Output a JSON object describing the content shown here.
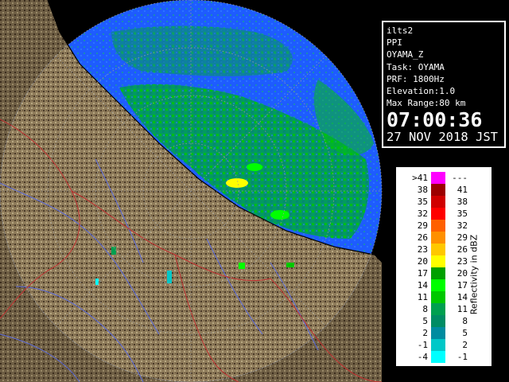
{
  "info": {
    "product": "ilts2",
    "scan_type": "PPI",
    "field": "OYAMA_Z",
    "task": "Task: OYAMA",
    "prf": "PRF: 1800Hz",
    "elevation": "Elevation:1.0",
    "max_range": "Max Range:80 km",
    "time": "07:00:36",
    "date": "27 NOV 2018 JST"
  },
  "legend": {
    "title": "Reflectivity in dBZ",
    "rows": [
      {
        "left": ">41",
        "right": "---",
        "color": "#ff00ff"
      },
      {
        "left": "38",
        "right": "41",
        "color": "#9c0000"
      },
      {
        "left": "35",
        "right": "38",
        "color": "#d00000"
      },
      {
        "left": "32",
        "right": "35",
        "color": "#ff0000"
      },
      {
        "left": "29",
        "right": "32",
        "color": "#ff6000"
      },
      {
        "left": "26",
        "right": "29",
        "color": "#ff9000"
      },
      {
        "left": "23",
        "right": "26",
        "color": "#ffc800"
      },
      {
        "left": "20",
        "right": "23",
        "color": "#ffff00"
      },
      {
        "left": "17",
        "right": "20",
        "color": "#00a000"
      },
      {
        "left": "14",
        "right": "17",
        "color": "#00ff00"
      },
      {
        "left": "11",
        "right": "14",
        "color": "#00c800"
      },
      {
        "left": "8",
        "right": "11",
        "color": "#00a050"
      },
      {
        "left": "5",
        "right": "8",
        "color": "#008c64"
      },
      {
        "left": "2",
        "right": "5",
        "color": "#008ca0"
      },
      {
        "left": "-1",
        "right": "2",
        "color": "#00c8c8"
      },
      {
        "left": "-4",
        "right": "-1",
        "color": "#00ffff"
      }
    ]
  },
  "colors": {
    "background": "#000000",
    "sea_echo": "#1e64ff",
    "land": "#8c7a5a",
    "range_ring": "#9a9a9a"
  },
  "icons": {
    "radar": "radar-ppi-display"
  }
}
